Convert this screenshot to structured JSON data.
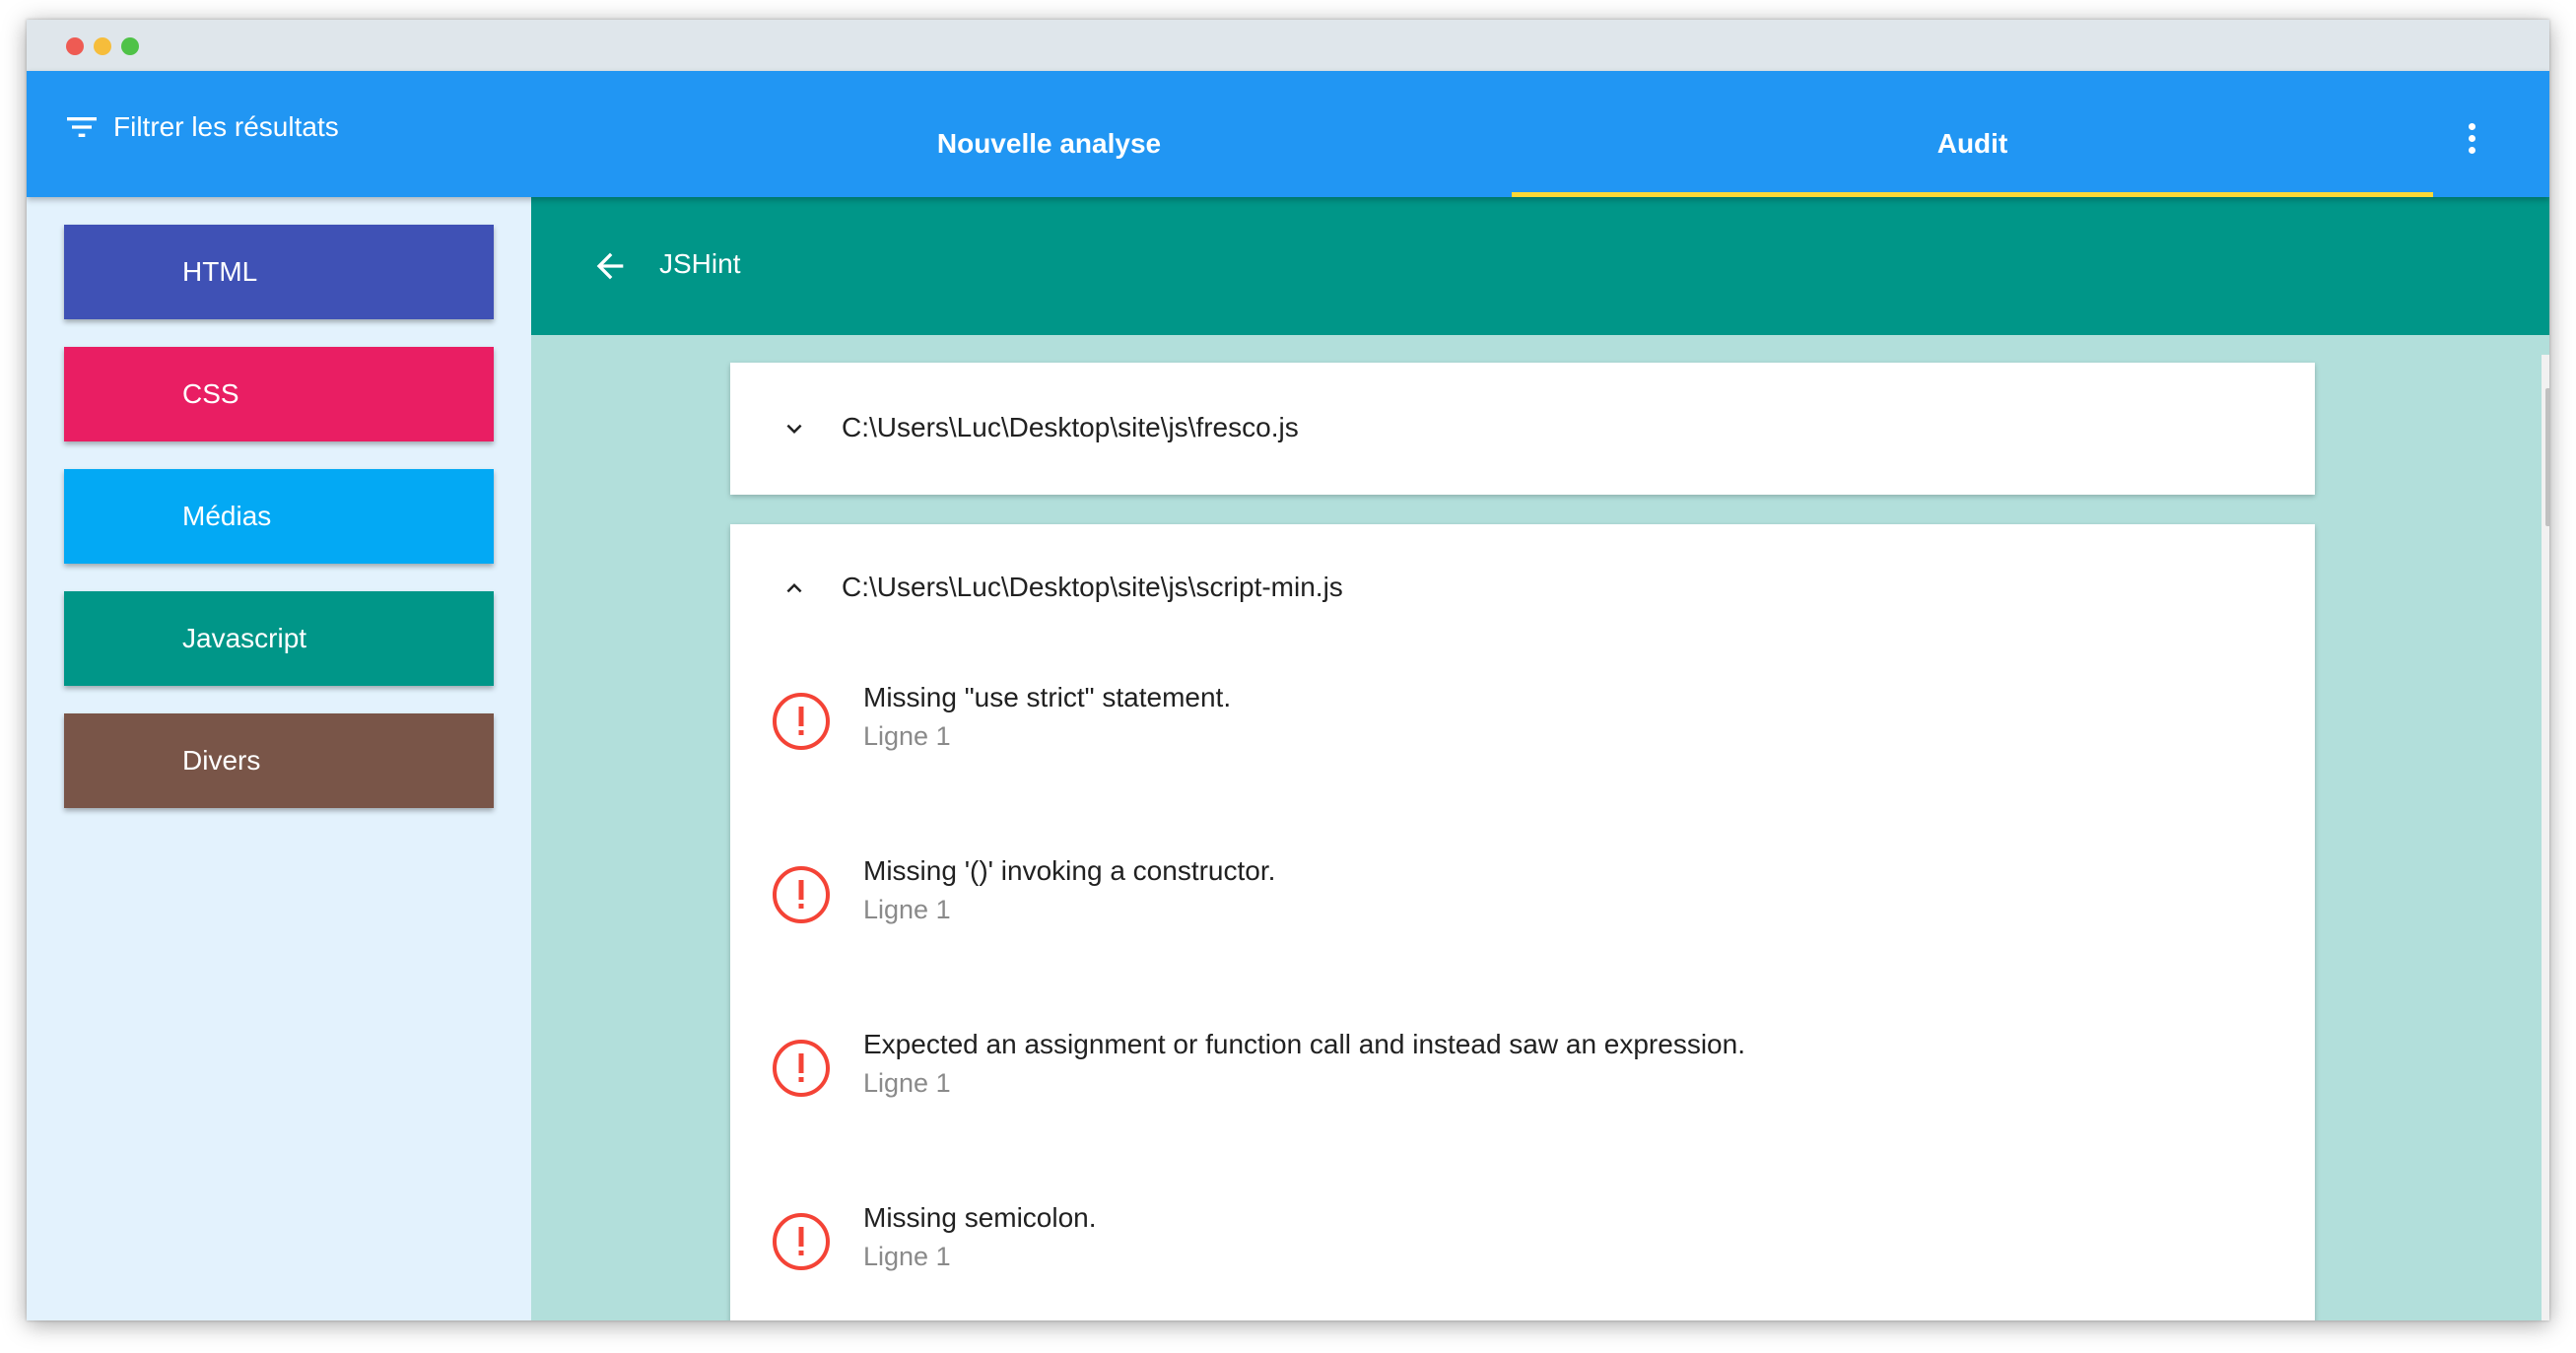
{
  "header": {
    "filter_label": "Filtrer les résultats",
    "tabs": [
      {
        "label": "Nouvelle analyse",
        "active": false
      },
      {
        "label": "Audit",
        "active": true
      }
    ]
  },
  "sidebar": {
    "items": [
      {
        "label": "HTML",
        "color": "#3f51b5"
      },
      {
        "label": "CSS",
        "color": "#e91e63"
      },
      {
        "label": "Médias",
        "color": "#03a9f4"
      },
      {
        "label": "Javascript",
        "color": "#009688"
      },
      {
        "label": "Divers",
        "color": "#795548"
      }
    ]
  },
  "subheader": {
    "title": "JSHint"
  },
  "files": [
    {
      "path": "C:\\Users\\Luc\\Desktop\\site\\js\\fresco.js",
      "expanded": false
    },
    {
      "path": "C:\\Users\\Luc\\Desktop\\site\\js\\script-min.js",
      "expanded": true,
      "issues": [
        {
          "message": "Missing \"use strict\" statement.",
          "line": "Ligne 1"
        },
        {
          "message": "Missing '()' invoking a constructor.",
          "line": "Ligne 1"
        },
        {
          "message": "Expected an assignment or function call and instead saw an expression.",
          "line": "Ligne 1"
        },
        {
          "message": "Missing semicolon.",
          "line": "Ligne 1"
        }
      ]
    }
  ],
  "colors": {
    "appbar": "#2196f3",
    "tab_indicator": "#fdd835",
    "subbar": "#009688",
    "content_bg": "#b2dfdb",
    "sidebar_bg": "#e3f2fd",
    "error": "#f44336"
  },
  "icons": {
    "filter": "filter-list-icon",
    "more": "more-vert-icon",
    "back": "arrow-back-icon",
    "collapsed": "chevron-down-icon",
    "expanded": "chevron-up-icon",
    "error": "error-circle-icon"
  }
}
